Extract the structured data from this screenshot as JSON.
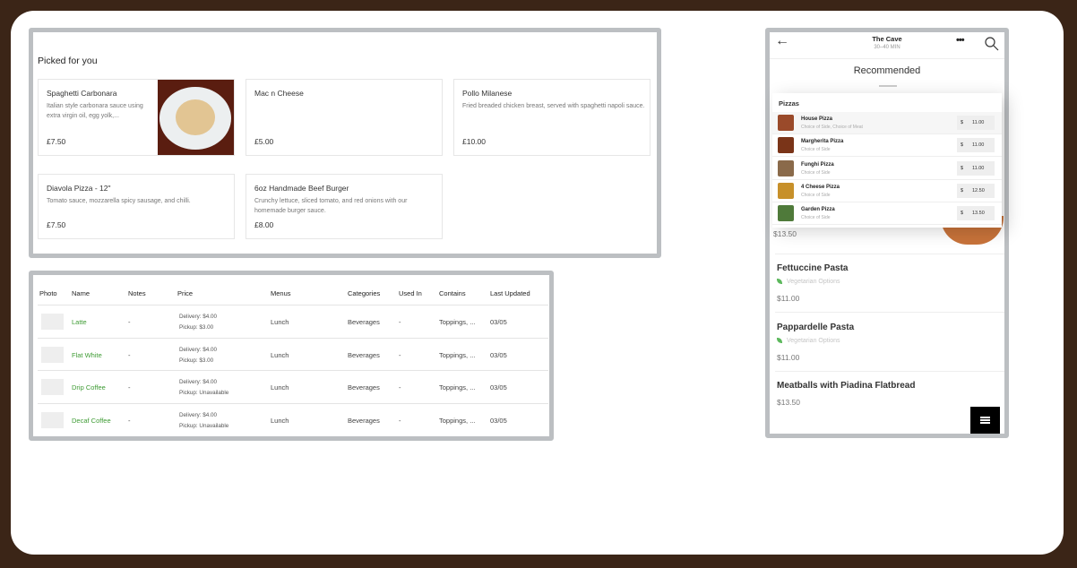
{
  "picked": {
    "title": "Picked for you",
    "cards": [
      {
        "name": "Spaghetti Carbonara",
        "desc": "Italian style carbonara sauce using extra virgin oil, egg yolk,...",
        "price": "£7.50"
      },
      {
        "name": "Mac n Cheese",
        "desc": "",
        "price": "£5.00"
      },
      {
        "name": "Pollo Milanese",
        "desc": "Fried breaded chicken breast, served with spaghetti napoli sauce.",
        "price": "£10.00"
      },
      {
        "name": "Diavola Pizza - 12\"",
        "desc": "Tomato sauce, mozzarella spicy sausage, and chilli.",
        "price": "£7.50"
      },
      {
        "name": "6oz Handmade Beef Burger",
        "desc": "Crunchy lettuce, sliced tomato, and red onions with our homemade burger sauce.",
        "price": "£8.00"
      }
    ]
  },
  "table": {
    "headers": [
      "Photo",
      "Name",
      "Notes",
      "Price",
      "Menus",
      "Categories",
      "Used In",
      "Contains",
      "Last Updated"
    ],
    "rows": [
      {
        "name": "Latte",
        "notes": "-",
        "delivery": "Delivery: $4.00",
        "pickup": "Pickup: $3.00",
        "menus": "Lunch",
        "categories": "Beverages",
        "used_in": "-",
        "contains": "Toppings, ...",
        "updated": "03/05"
      },
      {
        "name": "Flat White",
        "notes": "-",
        "delivery": "Delivery: $4.00",
        "pickup": "Pickup: $3.00",
        "menus": "Lunch",
        "categories": "Beverages",
        "used_in": "-",
        "contains": "Toppings, ...",
        "updated": "03/05"
      },
      {
        "name": "Drip Coffee",
        "notes": "-",
        "delivery": "Delivery: $4.00",
        "pickup": "Pickup: Unavailable",
        "menus": "Lunch",
        "categories": "Beverages",
        "used_in": "-",
        "contains": "Toppings, ...",
        "updated": "03/05"
      },
      {
        "name": "Decaf Coffee",
        "notes": "-",
        "delivery": "Delivery: $4.00",
        "pickup": "Pickup: Unavailable",
        "menus": "Lunch",
        "categories": "Beverages",
        "used_in": "-",
        "contains": "Toppings, ...",
        "updated": "03/05"
      }
    ],
    "name_color": "#3f9c35"
  },
  "phone": {
    "title": "The Cave",
    "subtitle": "30–40 MIN",
    "section": "Recommended",
    "popup": {
      "heading": "Pizzas",
      "currency": "$",
      "items": [
        {
          "name": "House Pizza",
          "sub": "Choice of Side, Choice of Meat",
          "price": "11.00"
        },
        {
          "name": "Margherita Pizza",
          "sub": "Choice of Side",
          "price": "11.00"
        },
        {
          "name": "Funghi Pizza",
          "sub": "Choice of Side",
          "price": "11.00"
        },
        {
          "name": "4 Cheese Pizza",
          "sub": "Choice of Side",
          "price": "12.50"
        },
        {
          "name": "Garden Pizza",
          "sub": "Choice of Side",
          "price": "13.50"
        }
      ]
    },
    "partial_price": "$13.50",
    "items": [
      {
        "name": "Fettuccine Pasta",
        "tag": "Vegetarian Options",
        "price": "$11.00"
      },
      {
        "name": "Pappardelle Pasta",
        "tag": "Vegetarian Options",
        "price": "$11.00"
      },
      {
        "name": "Meatballs with Piadina Flatbread",
        "price": "$13.50"
      }
    ]
  }
}
